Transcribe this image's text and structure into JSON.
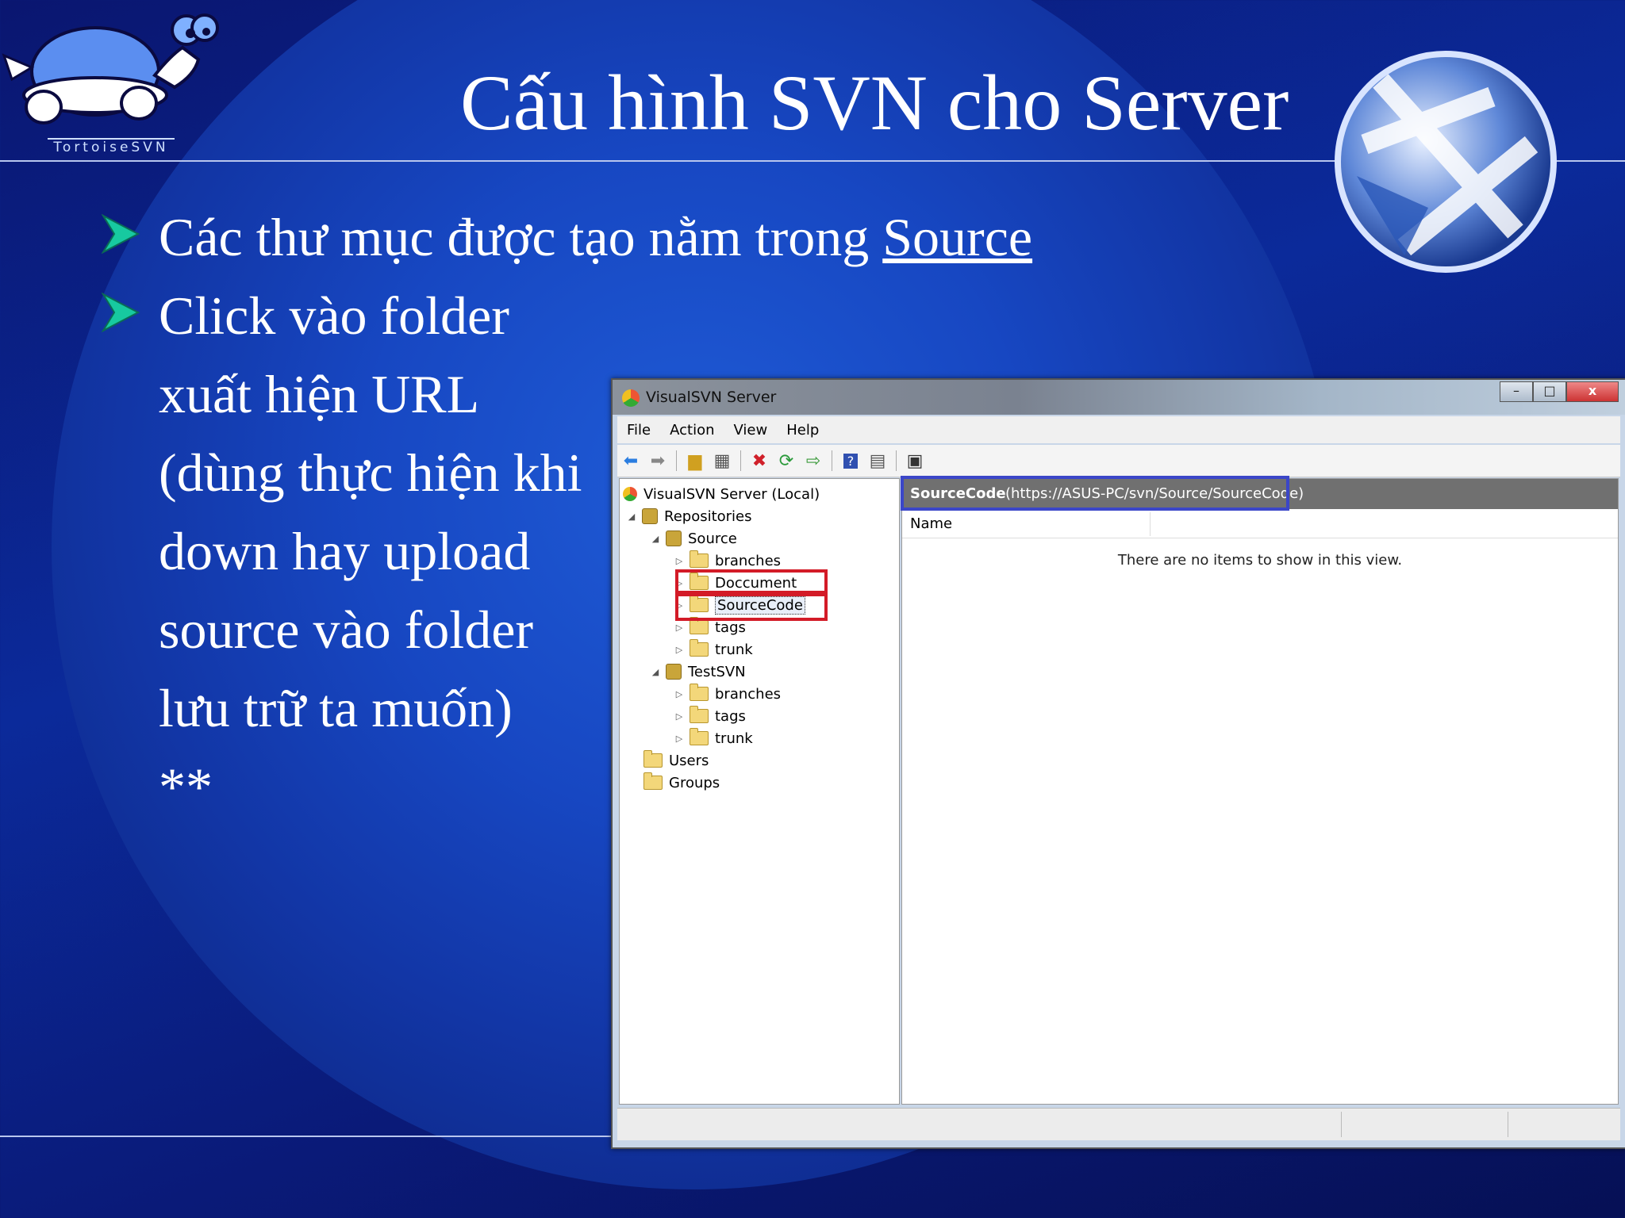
{
  "slide": {
    "title": "Cấu hình SVN cho Server",
    "logo_text": "TortoiseSVN",
    "bullets": [
      {
        "pre": "Các thư mục được tạo nằm trong ",
        "link": "Source "
      },
      {
        "pre": "Click vào folder",
        "link": ""
      }
    ],
    "continuation": [
      "xuất hiện URL",
      "(dùng  thực hiện khi",
      "down hay upload",
      "source vào folder",
      "lưu trữ ta muốn)",
      "**"
    ],
    "colors": {
      "accent_arrow": "#17c9a0",
      "highlight_red": "#d31b27",
      "highlight_blue": "#3b46c8"
    }
  },
  "window": {
    "title": "VisualSVN Server",
    "buttons": {
      "minimize": "–",
      "maximize": "□",
      "close": "x"
    },
    "menu": [
      "File",
      "Action",
      "View",
      "Help"
    ],
    "toolbar_icons": [
      "back-icon",
      "forward-icon",
      "up-folder-icon",
      "show-hide-icon",
      "delete-icon",
      "refresh-icon",
      "export-icon",
      "help-icon",
      "view-icon",
      "properties-icon"
    ],
    "tree": {
      "root": "VisualSVN Server (Local)",
      "repositories": "Repositories",
      "source": "Source",
      "source_children": [
        "branches",
        "Doccument",
        "SourceCode",
        "tags",
        "trunk"
      ],
      "testsvn": "TestSVN",
      "testsvn_children": [
        "branches",
        "tags",
        "trunk"
      ],
      "users": "Users",
      "groups": "Groups"
    },
    "right": {
      "name": "SourceCode",
      "url": "(https://ASUS-PC/svn/Source/SourceCode)",
      "column_name": "Name",
      "empty_message": "There are no items to show in this view."
    }
  }
}
